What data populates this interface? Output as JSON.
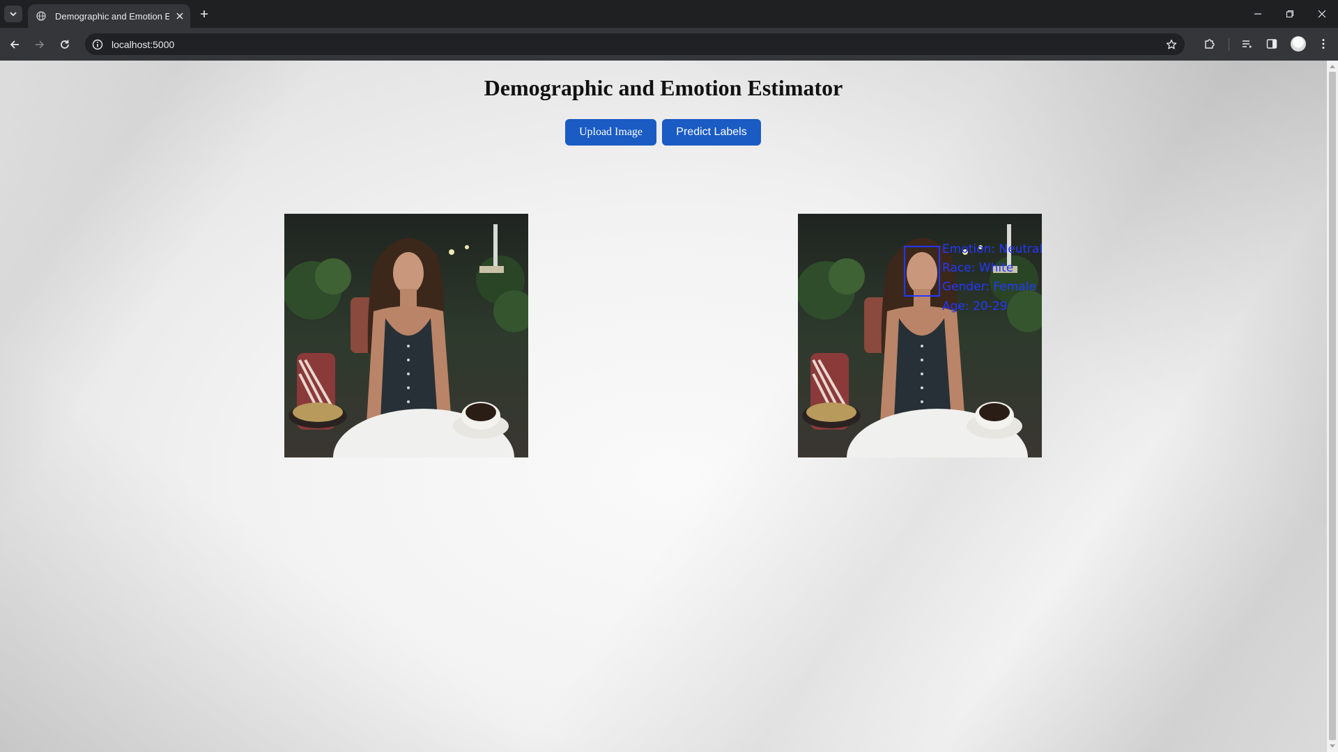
{
  "browser": {
    "tab_title": "Demographic and Emotion Estimator",
    "url": "localhost:5000",
    "icons": {
      "tab_search": "chevron-down-icon",
      "favicon": "globe-icon",
      "tab_close": "close-icon",
      "new_tab": "plus-icon",
      "back": "arrow-left-icon",
      "forward": "arrow-right-icon",
      "reload": "reload-icon",
      "site_info": "info-icon",
      "bookmark": "star-icon",
      "extensions": "puzzle-icon",
      "media": "media-queue-icon",
      "side_panel": "side-panel-icon",
      "menu": "kebab-menu-icon"
    }
  },
  "page": {
    "title": "Demographic and Emotion Estimator",
    "upload_button": "Upload Image",
    "predict_button": "Predict Labels",
    "accent_color": "#1a5bc4"
  },
  "prediction": {
    "emotion": "Emotion: Neutral",
    "race": "Race: White",
    "gender": "Gender: Female",
    "age": "Age: 20-29",
    "box_color": "#2238ff"
  }
}
